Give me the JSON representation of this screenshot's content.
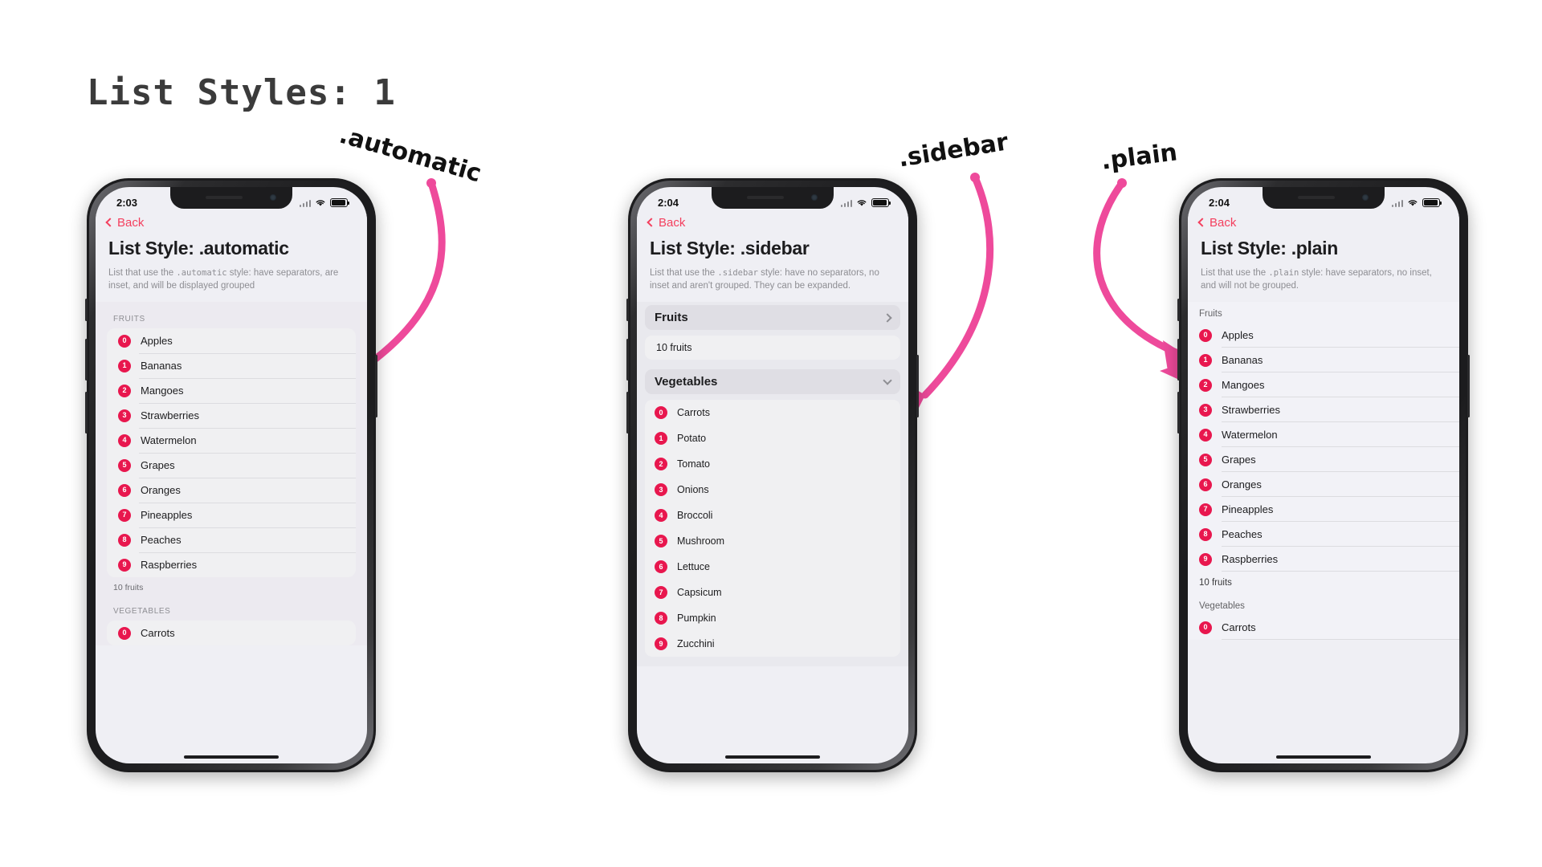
{
  "page": {
    "title": "List Styles: 1"
  },
  "annotations": [
    {
      "id": "automatic",
      "label": ".automatic"
    },
    {
      "id": "sidebar",
      "label": ".sidebar"
    },
    {
      "id": "plain",
      "label": ".plain"
    }
  ],
  "colors": {
    "accent_pink": "#ee4a9b",
    "badge_red": "#e8174e",
    "back_link": "#f43f5e",
    "title_dark": "#3b3b3b",
    "screen_bg": "#efeff4"
  },
  "phones": [
    {
      "id": "automatic",
      "status": {
        "time": "2:03",
        "wifi_icon": "wifi-icon",
        "battery_icon": "battery-icon",
        "signal_icon": "signal-icon"
      },
      "nav": {
        "back_label": "Back",
        "back_icon": "chevron-left-icon"
      },
      "header": {
        "title": "List Style: .automatic"
      },
      "description": {
        "pre": "List that use the ",
        "code": ".automatic",
        "post": " style: have separators, are inset, and will be displayed grouped"
      },
      "sections": [
        {
          "header": "FRUITS",
          "items": [
            {
              "index": "0",
              "name": "Apples"
            },
            {
              "index": "1",
              "name": "Bananas"
            },
            {
              "index": "2",
              "name": "Mangoes"
            },
            {
              "index": "3",
              "name": "Strawberries"
            },
            {
              "index": "4",
              "name": "Watermelon"
            },
            {
              "index": "5",
              "name": "Grapes"
            },
            {
              "index": "6",
              "name": "Oranges"
            },
            {
              "index": "7",
              "name": "Pineapples"
            },
            {
              "index": "8",
              "name": "Peaches"
            },
            {
              "index": "9",
              "name": "Raspberries"
            }
          ],
          "footer": "10 fruits"
        },
        {
          "header": "VEGETABLES",
          "items": [
            {
              "index": "0",
              "name": "Carrots"
            }
          ],
          "footer": ""
        }
      ]
    },
    {
      "id": "sidebar",
      "status": {
        "time": "2:04",
        "wifi_icon": "wifi-icon",
        "battery_icon": "battery-icon",
        "signal_icon": "signal-icon"
      },
      "nav": {
        "back_label": "Back",
        "back_icon": "chevron-left-icon"
      },
      "header": {
        "title": "List Style: .sidebar"
      },
      "description": {
        "pre": "List that use the ",
        "code": ".sidebar",
        "post": " style: have no separators, no inset and aren't grouped. They can be expanded."
      },
      "sections": [
        {
          "header": "Fruits",
          "disclosure_icon": "chevron-right-icon",
          "collapsed_summary": "10 fruits",
          "items": []
        },
        {
          "header": "Vegetables",
          "disclosure_icon": "chevron-down-icon",
          "collapsed_summary": "",
          "items": [
            {
              "index": "0",
              "name": "Carrots"
            },
            {
              "index": "1",
              "name": "Potato"
            },
            {
              "index": "2",
              "name": "Tomato"
            },
            {
              "index": "3",
              "name": "Onions"
            },
            {
              "index": "4",
              "name": "Broccoli"
            },
            {
              "index": "5",
              "name": "Mushroom"
            },
            {
              "index": "6",
              "name": "Lettuce"
            },
            {
              "index": "7",
              "name": "Capsicum"
            },
            {
              "index": "8",
              "name": "Pumpkin"
            },
            {
              "index": "9",
              "name": "Zucchini"
            }
          ]
        }
      ]
    },
    {
      "id": "plain",
      "status": {
        "time": "2:04",
        "wifi_icon": "wifi-icon",
        "battery_icon": "battery-icon",
        "signal_icon": "signal-icon"
      },
      "nav": {
        "back_label": "Back",
        "back_icon": "chevron-left-icon"
      },
      "header": {
        "title": "List Style: .plain"
      },
      "description": {
        "pre": "List that use the ",
        "code": ".plain",
        "post": " style: have separators, no inset, and will not be grouped."
      },
      "sections": [
        {
          "header": "Fruits",
          "items": [
            {
              "index": "0",
              "name": "Apples"
            },
            {
              "index": "1",
              "name": "Bananas"
            },
            {
              "index": "2",
              "name": "Mangoes"
            },
            {
              "index": "3",
              "name": "Strawberries"
            },
            {
              "index": "4",
              "name": "Watermelon"
            },
            {
              "index": "5",
              "name": "Grapes"
            },
            {
              "index": "6",
              "name": "Oranges"
            },
            {
              "index": "7",
              "name": "Pineapples"
            },
            {
              "index": "8",
              "name": "Peaches"
            },
            {
              "index": "9",
              "name": "Raspberries"
            }
          ],
          "footer": "10 fruits"
        },
        {
          "header": "Vegetables",
          "items": [
            {
              "index": "0",
              "name": "Carrots"
            }
          ],
          "footer": ""
        }
      ]
    }
  ]
}
